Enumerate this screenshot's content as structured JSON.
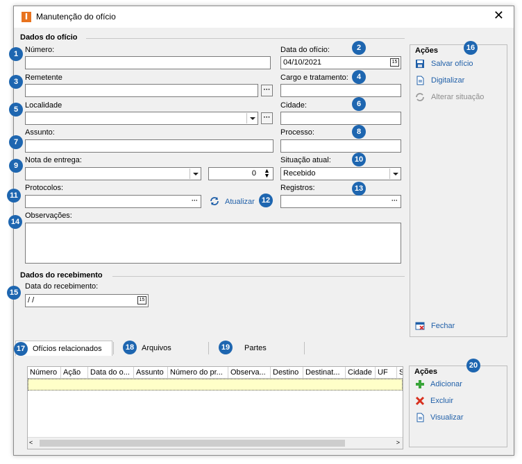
{
  "window": {
    "title": "Manutenção do ofício",
    "app_icon": "I",
    "close": "✕"
  },
  "sections": {
    "dados_oficio": "Dados do ofício",
    "dados_recebimento": "Dados do recebimento"
  },
  "fields": {
    "numero": {
      "label": "Número:",
      "value": ""
    },
    "data_oficio": {
      "label": "Data do ofício:",
      "value": "04/10/2021"
    },
    "remetente": {
      "label": "Remetente",
      "value": ""
    },
    "cargo": {
      "label": "Cargo e tratamento:",
      "value": ""
    },
    "localidade": {
      "label": "Localidade",
      "value": ""
    },
    "cidade": {
      "label": "Cidade:",
      "value": ""
    },
    "assunto": {
      "label": "Assunto:",
      "value": ""
    },
    "processo": {
      "label": "Processo:",
      "value": ""
    },
    "nota_entrega": {
      "label": "Nota de entrega:",
      "value": "",
      "count": "0"
    },
    "situacao": {
      "label": "Situação atual:",
      "value": "Recebido"
    },
    "protocolos": {
      "label": "Protocolos:",
      "value": "",
      "refresh": "Atualizar"
    },
    "registros": {
      "label": "Registros:",
      "value": ""
    },
    "observacoes": {
      "label": "Observações:",
      "value": ""
    },
    "data_recebimento": {
      "label": "Data do recebimento:",
      "value": " / /"
    }
  },
  "ellipsis": "···",
  "acoes_top": {
    "title": "Ações",
    "items": [
      "Salvar ofício",
      "Digitalizar",
      "Alterar situação"
    ],
    "close": "Fechar"
  },
  "tabs": [
    "Ofícios relacionados",
    "Arquivos",
    "Partes"
  ],
  "grid": {
    "columns": [
      "Número",
      "Ação",
      "Data do o...",
      "Assunto",
      "Número do pr...",
      "Observa...",
      "Destino",
      "Destinat...",
      "Cidade",
      "UF",
      "S"
    ]
  },
  "acoes_bottom": {
    "title": "Ações",
    "items": [
      "Adicionar",
      "Excluir",
      "Visualizar"
    ]
  },
  "badges": [
    "1",
    "2",
    "3",
    "4",
    "5",
    "6",
    "7",
    "8",
    "9",
    "10",
    "11",
    "12",
    "13",
    "14",
    "15",
    "16",
    "17",
    "18",
    "19",
    "20"
  ],
  "colors": {
    "badge": "#1e66b0",
    "link": "#1f5fa8",
    "selected_row": "#ffffc8"
  }
}
